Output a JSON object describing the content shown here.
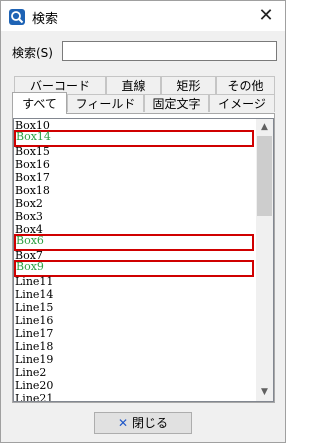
{
  "window": {
    "title": "検索",
    "close_glyph": "✕"
  },
  "search": {
    "label": "検索(S)",
    "value": "",
    "placeholder": ""
  },
  "tabs_row1": [
    {
      "label": "バーコード"
    },
    {
      "label": "直線"
    },
    {
      "label": "矩形"
    },
    {
      "label": "その他"
    }
  ],
  "tabs_row2": [
    {
      "label": "すべて",
      "active": true
    },
    {
      "label": "フィールド"
    },
    {
      "label": "固定文字"
    },
    {
      "label": "イメージ"
    }
  ],
  "list": {
    "items": [
      {
        "text": "Box10"
      },
      {
        "text": "Box14",
        "highlighted": true
      },
      {
        "text": "Box15"
      },
      {
        "text": "Box16"
      },
      {
        "text": "Box17"
      },
      {
        "text": "Box18"
      },
      {
        "text": "Box2"
      },
      {
        "text": "Box3"
      },
      {
        "text": "Box4"
      },
      {
        "text": "Box6",
        "highlighted": true
      },
      {
        "text": "Box7"
      },
      {
        "text": "Box9",
        "highlighted": true
      },
      {
        "text": "Line11"
      },
      {
        "text": "Line14"
      },
      {
        "text": "Line15"
      },
      {
        "text": "Line16"
      },
      {
        "text": "Line17"
      },
      {
        "text": "Line18"
      },
      {
        "text": "Line19"
      },
      {
        "text": "Line2"
      },
      {
        "text": "Line20"
      },
      {
        "text": "Line21"
      }
    ],
    "scroll_up": "▲",
    "scroll_down": "▼"
  },
  "footer": {
    "close_label": "閉じる",
    "close_icon_glyph": "✕"
  },
  "colors": {
    "highlight_border": "#d00000",
    "highlight_text": "#2ea043",
    "close_icon": "#1f57c9"
  },
  "icons": {
    "app": "search-app-icon",
    "close_window": "close-icon",
    "close_button": "x-icon"
  }
}
